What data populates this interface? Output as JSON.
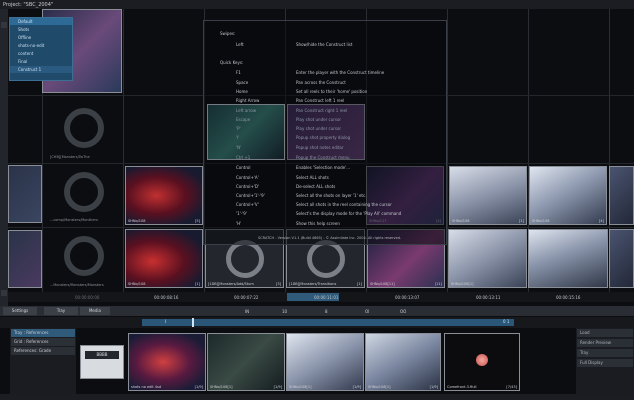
{
  "project_title": "Project: \"SBC_2004\"",
  "project_menu": [
    "Default",
    "Shots",
    "Offline",
    "shots-no-edit",
    "content",
    "Final",
    "Construct 1"
  ],
  "help": {
    "swipes_heading": "Swipes:",
    "rows_top": [
      {
        "key": "Left",
        "desc": "Show/hide the Construct list"
      }
    ],
    "quick_keys_heading": "Quick Keys:",
    "rows": [
      {
        "key": "F1",
        "desc": "Enter the player with the Construct timeline"
      },
      {
        "key": "Space",
        "desc": "Pan across the Construct"
      },
      {
        "key": "Home",
        "desc": "Set all reels to their 'home' position"
      },
      {
        "key": "Right Arrow",
        "desc": "Pan Construct left 1 reel"
      },
      {
        "key": "Left arrow",
        "desc": "Pan Construct right 1 reel"
      },
      {
        "key": "Escape",
        "desc": "Play shot under cursor"
      },
      {
        "key": "'P'",
        "desc": "Play shot under cursor"
      },
      {
        "key": "'I'",
        "desc": "Popup shot property dialog"
      },
      {
        "key": "'N'",
        "desc": "Popup shot notes editor"
      },
      {
        "key": "Ctrl +1",
        "desc": "Popup the Construct menu"
      },
      {
        "key": "Control",
        "desc": "Enables 'Selection mode'..."
      },
      {
        "key": "Control+'A'",
        "desc": "Select ALL shots"
      },
      {
        "key": "Control+'D'",
        "desc": "De-select ALL shots"
      },
      {
        "key": "Control+'1'-'9'",
        "desc": "Select all the shots on layer '1' etc."
      },
      {
        "key": "Control+'V'",
        "desc": "Select all shots in the reel containing the cursor"
      },
      {
        "key": "'1'-'9'",
        "desc": "Select's the display mode for the 'Play All' command"
      },
      {
        "key": "'H'",
        "desc": "Show this help screen"
      }
    ],
    "footer": "SCRATCH - Version V1.1 (Build 4665) - © Assimilate Inc. 2004. All rights reserved."
  },
  "grid": {
    "ring_captions": [
      "[CHB][Monsters/TwThe",
      "...comp/Monsters/Monthers",
      "...Monsters/Monsters/Monsters"
    ],
    "thumb_labels": [
      "SHNo/108",
      "SHNo/108",
      "SHNo/117",
      "SHNo/108",
      "SHNo/108",
      "SHNo/108[11]",
      "SHNo/108[1]",
      "[1DB][Monsters/Add/Stum",
      "[1DB][Monsters/Transitions"
    ],
    "thumb_counts": [
      "[5]",
      "[1]",
      "[4]",
      "[1]",
      "[4]",
      "[11]",
      "[1]",
      "[3]",
      "[1]"
    ]
  },
  "timecodes": [
    "00:00:00:00",
    "00:00:08:16",
    "00:00:07:22",
    "00:00:11:01",
    "00:00:13:07",
    "00:00:13:11",
    "00:00:15:16"
  ],
  "tabs": [
    "Settings",
    "Tray",
    "Media"
  ],
  "scrub": {
    "marks": [
      "IN",
      "10",
      "8",
      "OI",
      "OO"
    ],
    "left": "I",
    "right": "0 1"
  },
  "bin": {
    "items": [
      "Tray : References",
      "Grid : References",
      "References: Grade"
    ],
    "right_buttons": [
      "Load",
      "Render Preview",
      "Tray",
      "Full Display"
    ],
    "clips": [
      {
        "label": "shots no edit 4sd",
        "count": "[1/9]"
      },
      {
        "label": "SHNo/108[1]",
        "count": "[1/9]"
      },
      {
        "label": "SHNo/108[1]",
        "count": "[1/9]"
      },
      {
        "label": "SHNo/108[1]",
        "count": "[1/9]"
      },
      {
        "label": "Comefront.3.ffull",
        "count": "[7/43]"
      }
    ],
    "mini_label": "BBBB"
  },
  "colors": {
    "accent": "#2f5a7a",
    "selection": "#2d6a96",
    "panel": "#1b1d22"
  }
}
